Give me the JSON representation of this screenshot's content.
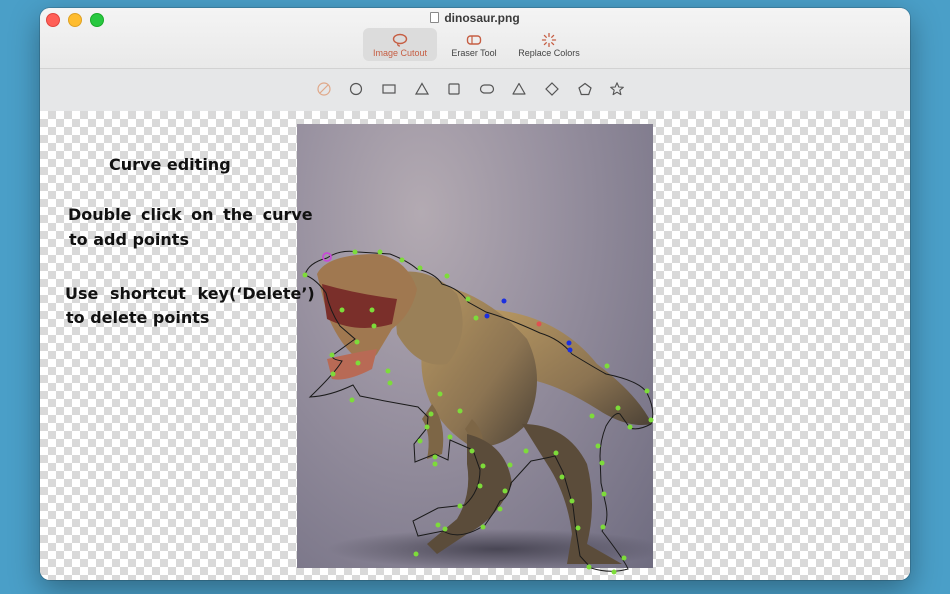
{
  "window": {
    "title": "dinosaur.png"
  },
  "modes": [
    {
      "label": "Image Cutout",
      "icon": "lasso-icon",
      "active": true
    },
    {
      "label": "Eraser Tool",
      "icon": "eraser-icon",
      "active": false
    },
    {
      "label": "Replace Colors",
      "icon": "sparkle-icon",
      "active": false
    }
  ],
  "shapes": [
    "freeform-lasso-icon",
    "circle-icon",
    "rectangle-icon",
    "triangle-icon",
    "square-icon",
    "rounded-rectangle-icon",
    "rounded-triangle-icon",
    "diamond-icon",
    "pentagon-icon",
    "star-icon"
  ],
  "instructions": {
    "heading": "Curve editing",
    "line1": "Double click on the curve",
    "line2": "to add points",
    "line3": "Use shortcut key(‘Delete’)",
    "line4": "to delete points"
  },
  "colors": {
    "accent": "#c65e43",
    "control_point": "#7ddc3a",
    "selected_point": "#1b2fe0",
    "active_point": "#e05050",
    "start_point": "#c64bd6"
  }
}
